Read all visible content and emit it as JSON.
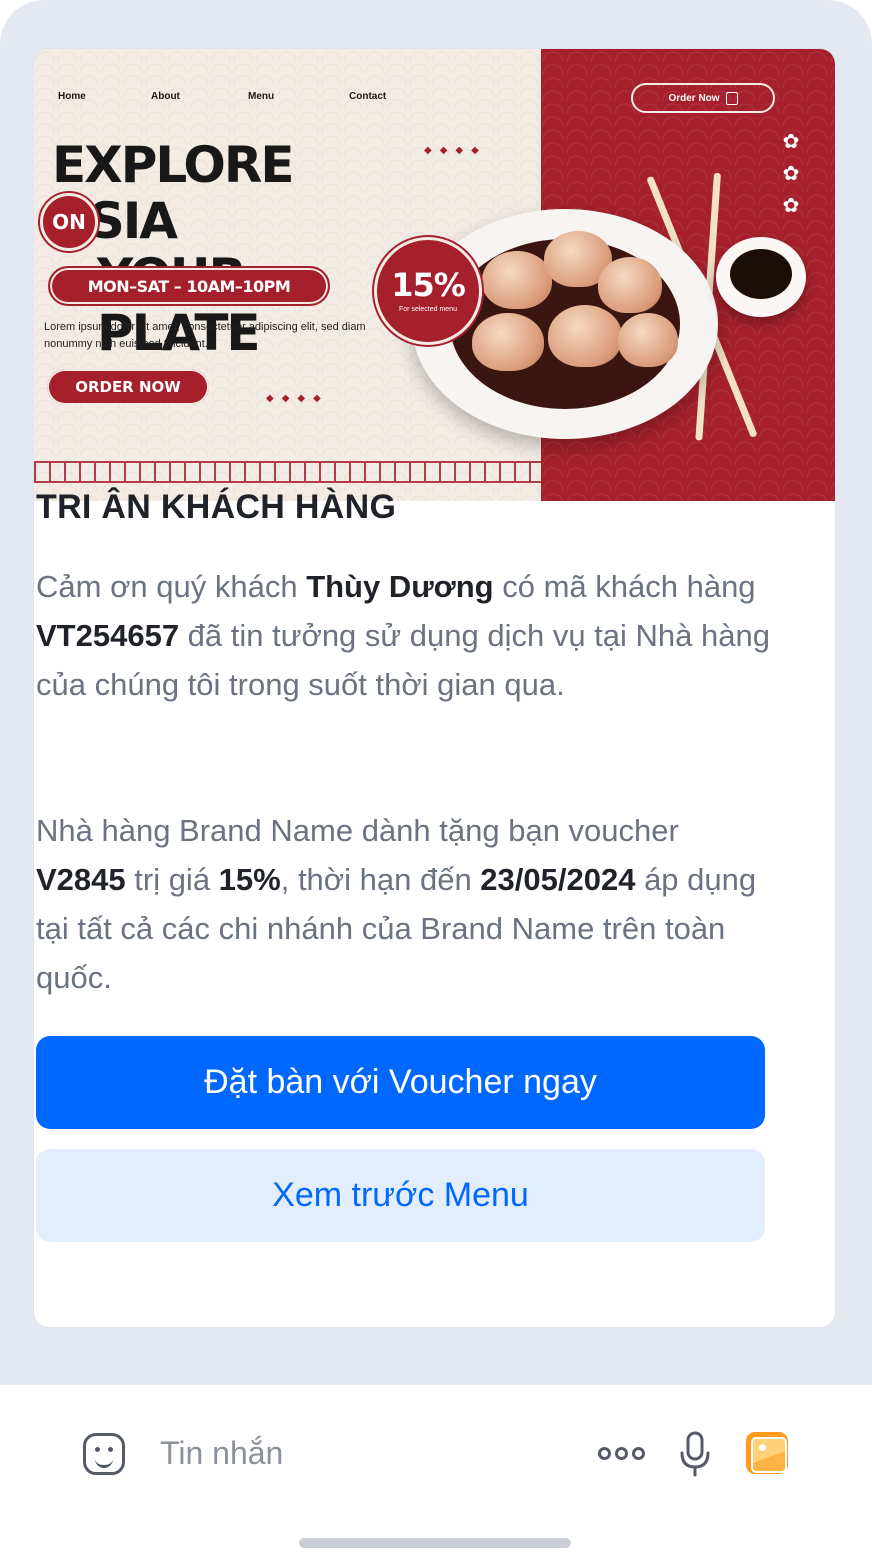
{
  "banner": {
    "nav": [
      "Home",
      "About",
      "Menu",
      "Contact"
    ],
    "order_now_label": "Order Now",
    "headline_line1": "EXPLORE ASIA",
    "headline_line2": "YOUR PLATE",
    "on_badge": "ON",
    "hours": "MON–SAT – 10AM–10PM",
    "lorem": "Lorem ipsum dolor sit amet, consectetuer adipiscing elit, sed diam nonummy nibh euismod tincidunt.",
    "order_button": "ORDER NOW",
    "discount_value": "15%",
    "discount_caption": "For selected menu",
    "accent_color": "#a5202c"
  },
  "message": {
    "title": "TRI ÂN KHÁCH HÀNG",
    "p1": {
      "a": "Cảm ơn quý khách ",
      "customer_name": "Thùy Dương",
      "b": " có mã khách hàng ",
      "customer_code": "VT254657",
      "c": " đã tin tưởng sử dụng dịch vụ tại Nhà hàng của chúng tôi trong suốt thời gian qua."
    },
    "p2": {
      "a": "Nhà hàng Brand Name dành tặng bạn voucher ",
      "voucher_code": "V2845",
      "b": " trị giá ",
      "voucher_value": "15%",
      "c": ", thời hạn đến ",
      "expiry_date": "23/05/2024",
      "d": " áp dụng tại tất cả các chi nhánh của Brand Name trên toàn quốc."
    },
    "primary_button": "Đặt bàn với Voucher ngay",
    "secondary_button": "Xem trước Menu",
    "primary_color": "#0068ff"
  },
  "composer": {
    "placeholder": "Tin nhắn",
    "icons": [
      "emoji-icon",
      "more-icon",
      "microphone-icon",
      "image-icon"
    ]
  }
}
